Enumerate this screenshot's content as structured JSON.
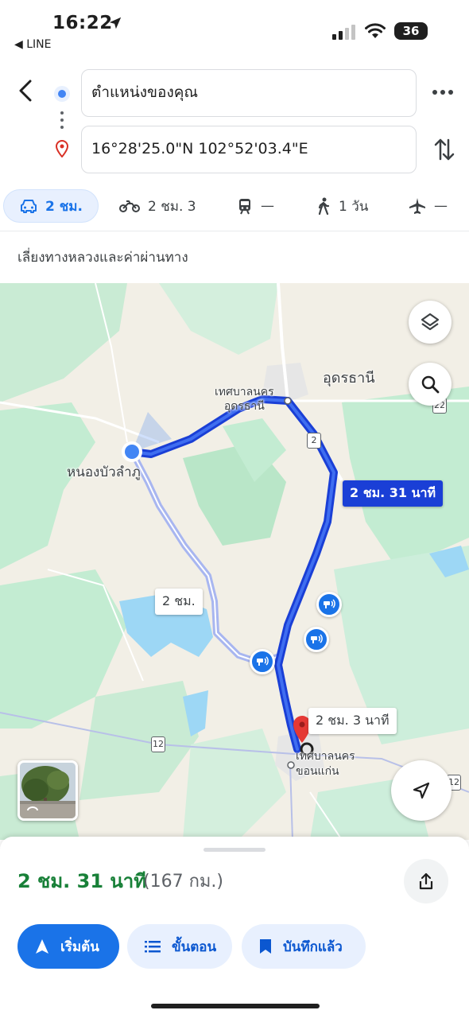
{
  "status": {
    "time": "16:22",
    "back_app": "◀ LINE",
    "battery": "36"
  },
  "search": {
    "origin": "ตำแหน่งของคุณ",
    "destination": "16°28'25.0\"N 102°52'03.4\"E"
  },
  "modes": [
    {
      "name": "car",
      "label": "2 ชม."
    },
    {
      "name": "motorcycle",
      "label": "2 ชม. 3"
    },
    {
      "name": "transit",
      "label": "—"
    },
    {
      "name": "walk",
      "label": "1 วัน"
    },
    {
      "name": "flight",
      "label": "—"
    }
  ],
  "options_text": "เลี่ยงทางหลวงและค่าผ่านทาง",
  "map": {
    "labels": {
      "udon_city": "อุดรธานี",
      "udon_municipality": [
        "เทศบาลนคร",
        "อุดรธานี"
      ],
      "nongbua": "หนองบัวลำภู",
      "khonkaen_municipality": [
        "เทศบาลนคร",
        "ขอนแก่น"
      ]
    },
    "route_chips": {
      "main": "2 ชม. 31 นาที",
      "alt1": "2 ชม.",
      "alt2": "2 ชม. 3 นาที"
    },
    "highway_shields": [
      "2",
      "12",
      "22",
      "12"
    ],
    "colors": {
      "route_main": "#1a3fd6",
      "route_alt": "#a8b6f0",
      "water": "#9dd7f5",
      "green": "#c3ecd2"
    }
  },
  "summary": {
    "duration": "2 ชม. 31 นาที",
    "distance": "(167 กม.)"
  },
  "buttons": {
    "start": "เริ่มต้น",
    "steps": "ขั้นตอน",
    "saved": "บันทึกแล้ว"
  }
}
